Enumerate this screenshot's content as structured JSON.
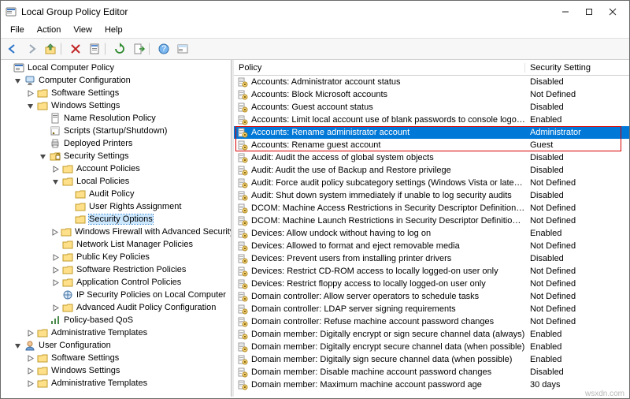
{
  "title": "Local Group Policy Editor",
  "menu": [
    "File",
    "Action",
    "View",
    "Help"
  ],
  "tree": [
    {
      "lvl": 0,
      "exp": "none",
      "icon": "policy",
      "label": "Local Computer Policy"
    },
    {
      "lvl": 1,
      "exp": "open",
      "icon": "computer",
      "label": "Computer Configuration"
    },
    {
      "lvl": 2,
      "exp": "closed",
      "icon": "folder",
      "label": "Software Settings"
    },
    {
      "lvl": 2,
      "exp": "open",
      "icon": "folder",
      "label": "Windows Settings"
    },
    {
      "lvl": 3,
      "exp": "none",
      "icon": "doc",
      "label": "Name Resolution Policy"
    },
    {
      "lvl": 3,
      "exp": "none",
      "icon": "script",
      "label": "Scripts (Startup/Shutdown)"
    },
    {
      "lvl": 3,
      "exp": "none",
      "icon": "printer",
      "label": "Deployed Printers"
    },
    {
      "lvl": 3,
      "exp": "open",
      "icon": "secfolder",
      "label": "Security Settings"
    },
    {
      "lvl": 4,
      "exp": "closed",
      "icon": "folder",
      "label": "Account Policies"
    },
    {
      "lvl": 4,
      "exp": "open",
      "icon": "folder",
      "label": "Local Policies",
      "sel": false
    },
    {
      "lvl": 5,
      "exp": "none",
      "icon": "folder",
      "label": "Audit Policy"
    },
    {
      "lvl": 5,
      "exp": "none",
      "icon": "folder",
      "label": "User Rights Assignment"
    },
    {
      "lvl": 5,
      "exp": "none",
      "icon": "folder",
      "label": "Security Options",
      "sel": true
    },
    {
      "lvl": 4,
      "exp": "closed",
      "icon": "folder",
      "label": "Windows Firewall with Advanced Security"
    },
    {
      "lvl": 4,
      "exp": "none",
      "icon": "folder",
      "label": "Network List Manager Policies"
    },
    {
      "lvl": 4,
      "exp": "closed",
      "icon": "folder",
      "label": "Public Key Policies"
    },
    {
      "lvl": 4,
      "exp": "closed",
      "icon": "folder",
      "label": "Software Restriction Policies"
    },
    {
      "lvl": 4,
      "exp": "closed",
      "icon": "folder",
      "label": "Application Control Policies"
    },
    {
      "lvl": 4,
      "exp": "none",
      "icon": "ipsec",
      "label": "IP Security Policies on Local Computer"
    },
    {
      "lvl": 4,
      "exp": "closed",
      "icon": "folder",
      "label": "Advanced Audit Policy Configuration"
    },
    {
      "lvl": 3,
      "exp": "none",
      "icon": "qos",
      "label": "Policy-based QoS"
    },
    {
      "lvl": 2,
      "exp": "closed",
      "icon": "folder",
      "label": "Administrative Templates"
    },
    {
      "lvl": 1,
      "exp": "open",
      "icon": "user",
      "label": "User Configuration"
    },
    {
      "lvl": 2,
      "exp": "closed",
      "icon": "folder",
      "label": "Software Settings"
    },
    {
      "lvl": 2,
      "exp": "closed",
      "icon": "folder",
      "label": "Windows Settings"
    },
    {
      "lvl": 2,
      "exp": "closed",
      "icon": "folder",
      "label": "Administrative Templates"
    }
  ],
  "listHeader": {
    "col1": "Policy",
    "col2": "Security Setting"
  },
  "policies": [
    {
      "name": "Accounts: Administrator account status",
      "set": "Disabled"
    },
    {
      "name": "Accounts: Block Microsoft accounts",
      "set": "Not Defined"
    },
    {
      "name": "Accounts: Guest account status",
      "set": "Disabled"
    },
    {
      "name": "Accounts: Limit local account use of blank passwords to console logon only",
      "set": "Enabled"
    },
    {
      "name": "Accounts: Rename administrator account",
      "set": "Administrator",
      "sel": true
    },
    {
      "name": "Accounts: Rename guest account",
      "set": "Guest"
    },
    {
      "name": "Audit: Audit the access of global system objects",
      "set": "Disabled"
    },
    {
      "name": "Audit: Audit the use of Backup and Restore privilege",
      "set": "Disabled"
    },
    {
      "name": "Audit: Force audit policy subcategory settings (Windows Vista or later) to ov...",
      "set": "Not Defined"
    },
    {
      "name": "Audit: Shut down system immediately if unable to log security audits",
      "set": "Disabled"
    },
    {
      "name": "DCOM: Machine Access Restrictions in Security Descriptor Definition Langua...",
      "set": "Not Defined"
    },
    {
      "name": "DCOM: Machine Launch Restrictions in Security Descriptor Definition Langua...",
      "set": "Not Defined"
    },
    {
      "name": "Devices: Allow undock without having to log on",
      "set": "Enabled"
    },
    {
      "name": "Devices: Allowed to format and eject removable media",
      "set": "Not Defined"
    },
    {
      "name": "Devices: Prevent users from installing printer drivers",
      "set": "Disabled"
    },
    {
      "name": "Devices: Restrict CD-ROM access to locally logged-on user only",
      "set": "Not Defined"
    },
    {
      "name": "Devices: Restrict floppy access to locally logged-on user only",
      "set": "Not Defined"
    },
    {
      "name": "Domain controller: Allow server operators to schedule tasks",
      "set": "Not Defined"
    },
    {
      "name": "Domain controller: LDAP server signing requirements",
      "set": "Not Defined"
    },
    {
      "name": "Domain controller: Refuse machine account password changes",
      "set": "Not Defined"
    },
    {
      "name": "Domain member: Digitally encrypt or sign secure channel data (always)",
      "set": "Enabled"
    },
    {
      "name": "Domain member: Digitally encrypt secure channel data (when possible)",
      "set": "Enabled"
    },
    {
      "name": "Domain member: Digitally sign secure channel data (when possible)",
      "set": "Enabled"
    },
    {
      "name": "Domain member: Disable machine account password changes",
      "set": "Disabled"
    },
    {
      "name": "Domain member: Maximum machine account password age",
      "set": "30 days"
    }
  ],
  "watermark": "wsxdn.com"
}
